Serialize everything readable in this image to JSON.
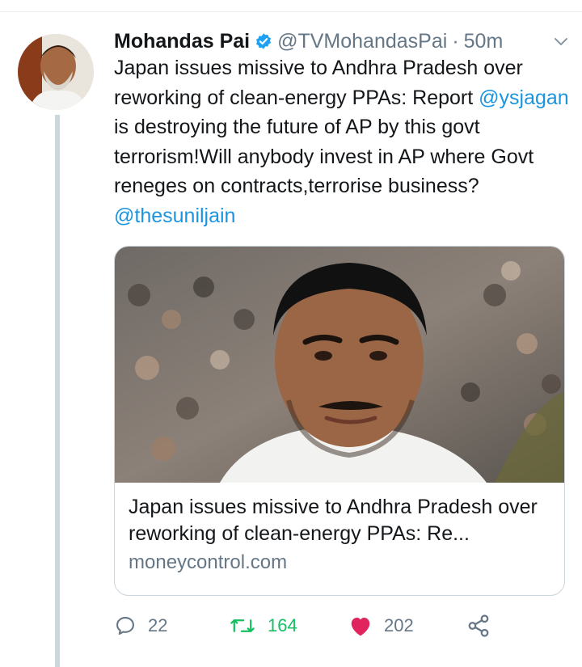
{
  "tweet": {
    "author_name": "Mohandas Pai",
    "author_handle": "@TVMohandasPai",
    "separator": "·",
    "time": "50m",
    "text_main": "Japan issues missive to Andhra Pradesh over reworking of clean-energy PPAs: Report ",
    "mention_1": "@ysjagan",
    "text_mid": " is destroying the future of AP by this govt terrorism!Will anybody invest in AP where Govt reneges on contracts,terrorise business?",
    "mention_2": "@thesuniljain",
    "verified_icon": "verified-badge-icon",
    "caret_icon": "chevron-down-icon",
    "accent_color": "#1b95e0"
  },
  "card": {
    "title": "Japan issues missive to Andhra Pradesh over reworking of clean-energy PPAs: Re...",
    "domain": "moneycontrol.com",
    "image_icon": "news-photo-image"
  },
  "actions": {
    "reply_count": "22",
    "retweet_count": "164",
    "like_count": "202",
    "reply_icon": "reply-icon",
    "retweet_icon": "retweet-icon",
    "like_icon": "heart-icon",
    "share_icon": "share-icon",
    "retweet_color": "#17bf63",
    "like_color": "#e0245e"
  }
}
